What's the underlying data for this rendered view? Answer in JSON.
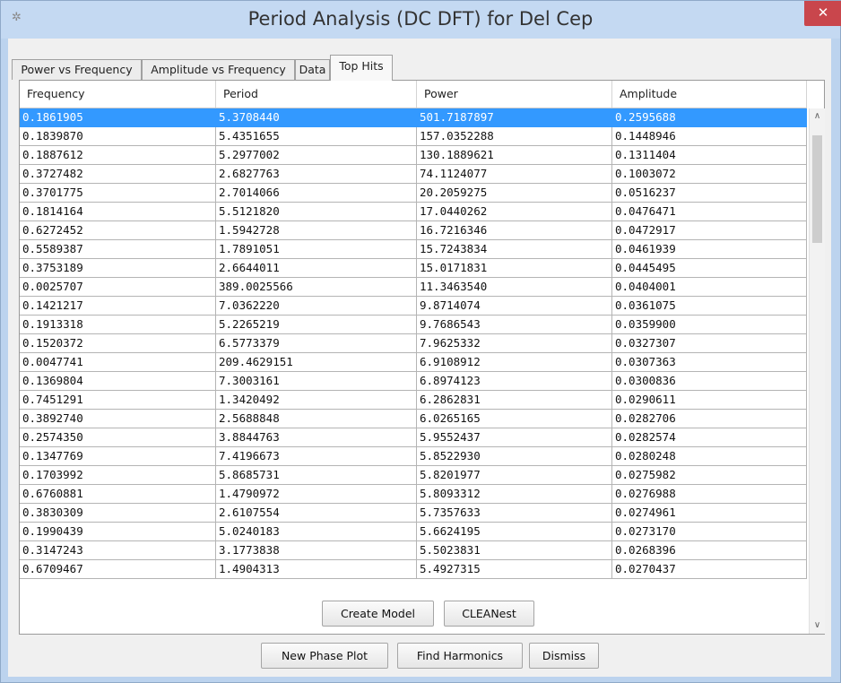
{
  "window": {
    "title": "Period Analysis (DC DFT) for Del Cep",
    "close_glyph": "✕",
    "app_icon_glyph": "✲"
  },
  "tabs": [
    {
      "label": "Power vs Frequency",
      "active": false
    },
    {
      "label": "Amplitude vs Frequency",
      "active": false
    },
    {
      "label": "Data",
      "active": false
    },
    {
      "label": "Top Hits",
      "active": true
    }
  ],
  "table": {
    "columns": [
      "Frequency",
      "Period",
      "Power",
      "Amplitude"
    ],
    "selected_row": 0,
    "rows": [
      [
        "0.1861905",
        "5.3708440",
        "501.7187897",
        "0.2595688"
      ],
      [
        "0.1839870",
        "5.4351655",
        "157.0352288",
        "0.1448946"
      ],
      [
        "0.1887612",
        "5.2977002",
        "130.1889621",
        "0.1311404"
      ],
      [
        "0.3727482",
        "2.6827763",
        "74.1124077",
        "0.1003072"
      ],
      [
        "0.3701775",
        "2.7014066",
        "20.2059275",
        "0.0516237"
      ],
      [
        "0.1814164",
        "5.5121820",
        "17.0440262",
        "0.0476471"
      ],
      [
        "0.6272452",
        "1.5942728",
        "16.7216346",
        "0.0472917"
      ],
      [
        "0.5589387",
        "1.7891051",
        "15.7243834",
        "0.0461939"
      ],
      [
        "0.3753189",
        "2.6644011",
        "15.0171831",
        "0.0445495"
      ],
      [
        "0.0025707",
        "389.0025566",
        "11.3463540",
        "0.0404001"
      ],
      [
        "0.1421217",
        "7.0362220",
        "9.8714074",
        "0.0361075"
      ],
      [
        "0.1913318",
        "5.2265219",
        "9.7686543",
        "0.0359900"
      ],
      [
        "0.1520372",
        "6.5773379",
        "7.9625332",
        "0.0327307"
      ],
      [
        "0.0047741",
        "209.4629151",
        "6.9108912",
        "0.0307363"
      ],
      [
        "0.1369804",
        "7.3003161",
        "6.8974123",
        "0.0300836"
      ],
      [
        "0.7451291",
        "1.3420492",
        "6.2862831",
        "0.0290611"
      ],
      [
        "0.3892740",
        "2.5688848",
        "6.0265165",
        "0.0282706"
      ],
      [
        "0.2574350",
        "3.8844763",
        "5.9552437",
        "0.0282574"
      ],
      [
        "0.1347769",
        "7.4196673",
        "5.8522930",
        "0.0280248"
      ],
      [
        "0.1703992",
        "5.8685731",
        "5.8201977",
        "0.0275982"
      ],
      [
        "0.6760881",
        "1.4790972",
        "5.8093312",
        "0.0276988"
      ],
      [
        "0.3830309",
        "2.6107554",
        "5.7357633",
        "0.0274961"
      ],
      [
        "0.1990439",
        "5.0240183",
        "5.6624195",
        "0.0273170"
      ],
      [
        "0.3147243",
        "3.1773838",
        "5.5023831",
        "0.0268396"
      ],
      [
        "0.6709467",
        "1.4904313",
        "5.4927315",
        "0.0270437"
      ]
    ]
  },
  "scrollbar": {
    "up_glyph": "∧",
    "down_glyph": "∨"
  },
  "buttons": {
    "create_model": "Create Model",
    "cleanest": "CLEANest",
    "new_phase_plot": "New Phase Plot",
    "find_harmonics": "Find Harmonics",
    "dismiss": "Dismiss"
  },
  "colors": {
    "selection": "#3399ff",
    "close_button": "#c9464c",
    "window_frame": "#bcd3ee"
  }
}
